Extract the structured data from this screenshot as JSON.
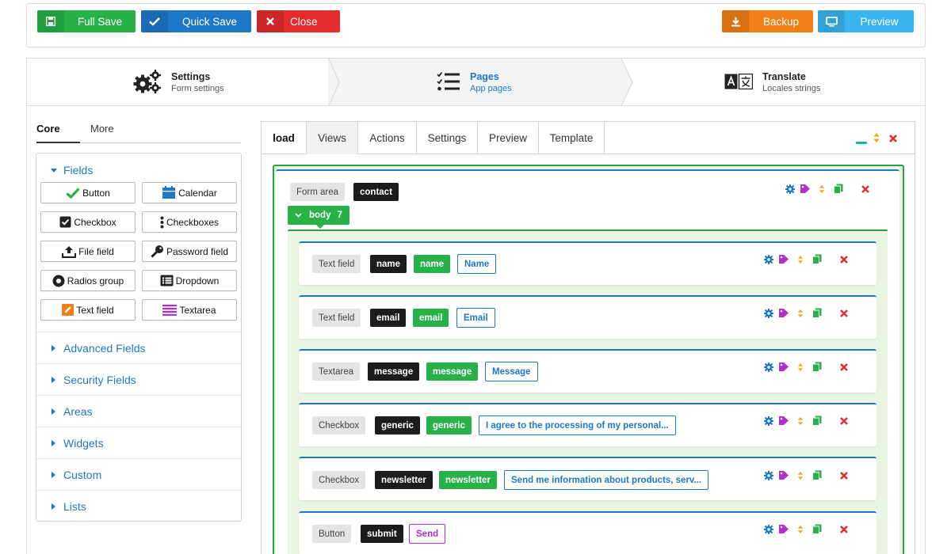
{
  "toolbar": {
    "full_save": "Full Save",
    "quick_save": "Quick Save",
    "close": "Close",
    "backup": "Backup",
    "preview": "Preview"
  },
  "steps": [
    {
      "title": "Settings",
      "subtitle": "Form settings",
      "icon": "gears-icon"
    },
    {
      "title": "Pages",
      "subtitle": "App pages",
      "icon": "list-check-icon"
    },
    {
      "title": "Translate",
      "subtitle": "Locales strings",
      "icon": "language-icon"
    }
  ],
  "left_tabs": {
    "core": "Core",
    "more": "More"
  },
  "fields_section": {
    "title": "Fields",
    "buttons": [
      {
        "label": "Button",
        "icon": "check-icon"
      },
      {
        "label": "Calendar",
        "icon": "calendar-icon"
      },
      {
        "label": "Checkbox",
        "icon": "checkbox-icon"
      },
      {
        "label": "Checkboxes",
        "icon": "ellipsis-vertical-icon"
      },
      {
        "label": "File field",
        "icon": "upload-icon"
      },
      {
        "label": "Password field",
        "icon": "key-icon"
      },
      {
        "label": "Radios group",
        "icon": "radio-icon"
      },
      {
        "label": "Dropdown",
        "icon": "list-box-icon"
      },
      {
        "label": "Text field",
        "icon": "pencil-square-icon"
      },
      {
        "label": "Textarea",
        "icon": "align-justify-icon"
      }
    ]
  },
  "accordion": [
    "Advanced Fields",
    "Security Fields",
    "Areas",
    "Widgets",
    "Custom",
    "Lists"
  ],
  "right_tabs": [
    "load",
    "Views",
    "Actions",
    "Settings",
    "Preview",
    "Template"
  ],
  "form_area": {
    "type": "Form area",
    "name": "contact"
  },
  "body": {
    "label": "body",
    "count": "7"
  },
  "rows": [
    {
      "type": "Text field",
      "name": "name",
      "id": "name",
      "label": "Name",
      "label_style": "blue"
    },
    {
      "type": "Text field",
      "name": "email",
      "id": "email",
      "label": "Email",
      "label_style": "blue"
    },
    {
      "type": "Textarea",
      "name": "message",
      "id": "message",
      "label": "Message",
      "label_style": "blue"
    },
    {
      "type": "Checkbox",
      "name": "generic",
      "id": "generic",
      "label": "I agree to the processing of my personal...",
      "label_style": "blue"
    },
    {
      "type": "Checkbox",
      "name": "newsletter",
      "id": "newsletter",
      "label": "Send me information about products, serv...",
      "label_style": "blue"
    },
    {
      "type": "Button",
      "name": "submit",
      "id": "",
      "label": "Send",
      "label_style": "purple"
    }
  ],
  "colors": {
    "green": "#27b148",
    "blue": "#1e78c8",
    "red": "#e52b2b",
    "orange": "#f07f16",
    "sky": "#38b4ef",
    "purple": "#b02ecb"
  }
}
